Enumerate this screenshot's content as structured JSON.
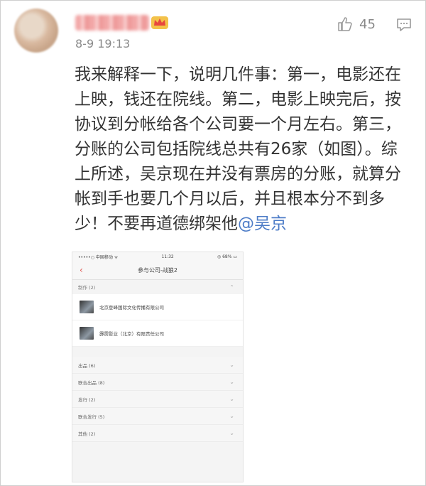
{
  "post": {
    "timestamp": "8-9 19:13",
    "like_count": "45",
    "text_main": "我来解释一下，说明几件事：第一，电影还在上映，钱还在院线。第二，电影上映完后，按协议到分帐给各个公司要一个月左右。第三，分账的公司包括院线总共有26家（如图）。综上所述，吴京现在并没有票房的分账，就算分帐到手也要几个月以后，并且根本分不到多少！不要再道德绑架他",
    "mention": "@吴京"
  },
  "screenshot": {
    "statusbar": {
      "carrier": "•••••○ 中国移动 ᯤ",
      "time": "11:32",
      "battery": "◎ 68% ▭"
    },
    "nav_title": "参与公司-战狼2",
    "section": {
      "label": "制作 (2)"
    },
    "companies": [
      {
        "name": "北京登峰国际文化传播有限公司"
      },
      {
        "name": "霹雳影业（北京）有限责任公司"
      }
    ],
    "categories": [
      {
        "label": "出品 (6)"
      },
      {
        "label": "联合出品 (8)"
      },
      {
        "label": "发行 (2)"
      },
      {
        "label": "联合发行 (5)"
      },
      {
        "label": "其他 (2)"
      }
    ]
  }
}
